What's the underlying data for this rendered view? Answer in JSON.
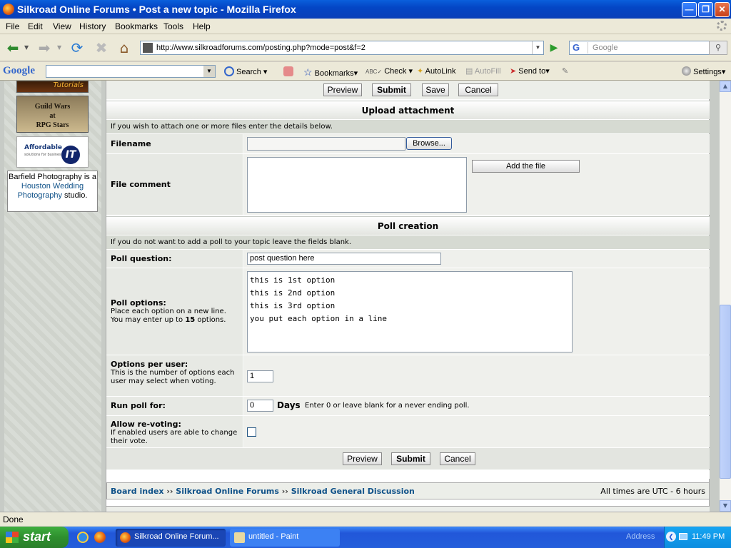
{
  "window": {
    "title": "Silkroad Online Forums • Post a new topic - Mozilla Firefox"
  },
  "menu": [
    "File",
    "Edit",
    "View",
    "History",
    "Bookmarks",
    "Tools",
    "Help"
  ],
  "nav": {
    "url": "http://www.silkroadforums.com/posting.php?mode=post&f=2",
    "search_placeholder": "Google",
    "search_engine_icon": "G"
  },
  "gtoolbar": {
    "logo": "Google",
    "search": "Search",
    "bookmarks": "Bookmarks",
    "check": "Check",
    "autolink": "AutoLink",
    "autofill": "AutoFill",
    "sendto": "Send to",
    "settings": "Settings"
  },
  "sidebar": {
    "ad1": "Tutorials",
    "ad2_line1": "Guild Wars",
    "ad2_line2": "at",
    "ad2_line3": "RPG Stars",
    "ad3_name": "Affordable",
    "ad3_tag": "solutions for business",
    "ad3_it": "IT",
    "barfield_pre": "Barfield Photography is a ",
    "barfield_link": "Houston Wedding Photography",
    "barfield_post": " studio."
  },
  "top_buttons": {
    "preview": "Preview",
    "submit": "Submit",
    "save": "Save",
    "cancel": "Cancel"
  },
  "upload": {
    "header": "Upload attachment",
    "note": "If you wish to attach one or more files enter the details below.",
    "filename_label": "Filename",
    "browse": "Browse...",
    "comment_label": "File comment",
    "add_file": "Add the file"
  },
  "poll": {
    "header": "Poll creation",
    "note": "If you do not want to add a poll to your topic leave the fields blank.",
    "question_label": "Poll question:",
    "question_value": "post question here",
    "options_label": "Poll options:",
    "options_help1": "Place each option on a new line.",
    "options_help2_pre": "You may enter up to ",
    "options_help2_num": "15",
    "options_help2_post": " options.",
    "options_lines": [
      "this is 1st option",
      "this is 2nd option",
      "this is 3rd option",
      "you put each option in a line"
    ],
    "per_user_label": "Options per user:",
    "per_user_help": "This is the number of options each user may select when voting.",
    "per_user_value": "1",
    "run_label": "Run poll for:",
    "run_value": "0",
    "run_days": "Days",
    "run_help": "Enter 0 or leave blank for a never ending poll.",
    "revote_label": "Allow re-voting:",
    "revote_help": "If enabled users are able to change their vote.",
    "revote_checked": false
  },
  "bottom_buttons": {
    "preview": "Preview",
    "submit": "Submit",
    "cancel": "Cancel"
  },
  "footer": {
    "crumbs": [
      "Board index",
      "Silkroad Online Forums",
      "Silkroad General Discussion"
    ],
    "sep": "››",
    "times": "All times are UTC - 6 hours"
  },
  "status": "Done",
  "taskbar": {
    "start": "start",
    "task1": "Silkroad Online Forum...",
    "task2": "untitled - Paint",
    "address": "Address",
    "clock": "11:49 PM"
  }
}
